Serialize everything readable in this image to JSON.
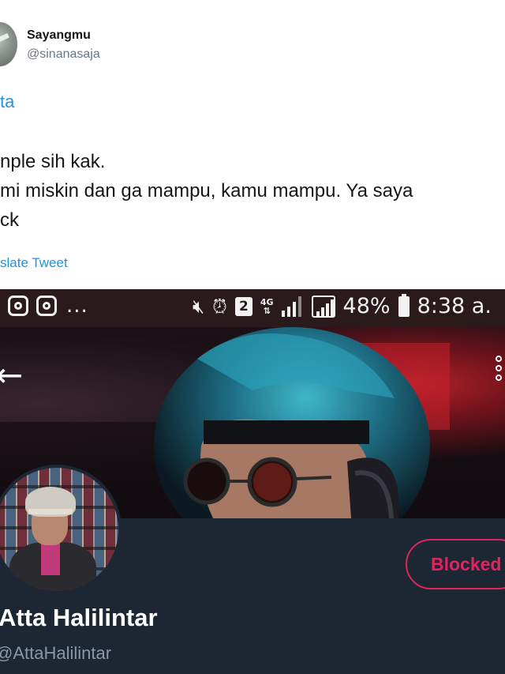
{
  "tweet": {
    "author_name": "Sayangmu",
    "author_handle": "@sinanasaja",
    "reply_to": "ta",
    "text_lines": [
      "nple sih kak.",
      "mi miskin dan ga mampu, kamu mampu. Ya saya",
      "ck"
    ],
    "translate_label": "slate Tweet"
  },
  "screenshot": {
    "status_bar": {
      "left_more": "...",
      "sim_slot": "2",
      "network": "4G",
      "battery": "48%",
      "time": "8:38 a."
    },
    "profile": {
      "name": "Atta Halilintar",
      "handle": "@AttaHalilintar",
      "blocked_label": "Blocked"
    }
  },
  "colors": {
    "link": "#1b95e0",
    "blocked": "#e0245e",
    "dark_bg": "#1c2733"
  }
}
